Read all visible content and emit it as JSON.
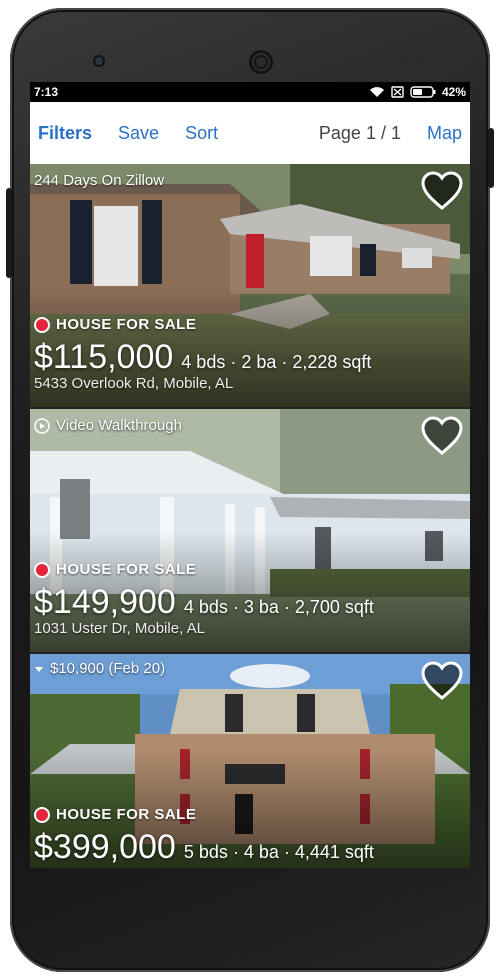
{
  "status_bar": {
    "time": "7:13",
    "battery": "42%",
    "wifi_icon": "wifi-icon",
    "sim_icon": "no-sim-icon",
    "battery_icon": "battery-icon"
  },
  "toolbar": {
    "filters": "Filters",
    "save": "Save",
    "sort": "Sort",
    "page": "Page 1 / 1",
    "map": "Map"
  },
  "listings": [
    {
      "top_label": "244 Days On Zillow",
      "status": "HOUSE FOR SALE",
      "price": "$115,000",
      "specs": "4 bds · 2 ba · 2,228 sqft",
      "address": "5433 Overlook Rd, Mobile, AL"
    },
    {
      "top_label": "Video Walkthrough",
      "status": "HOUSE FOR SALE",
      "price": "$149,900",
      "specs": "4 bds · 3 ba · 2,700 sqft",
      "address": "1031 Uster Dr, Mobile, AL"
    },
    {
      "top_label": "$10,900 (Feb 20)",
      "status": "HOUSE FOR SALE",
      "price": "$399,000",
      "specs": "5 bds · 4 ba · 4,441 sqft",
      "address": ""
    }
  ],
  "colors": {
    "accent": "#2a70c8",
    "status_dot": "#e4253c"
  }
}
